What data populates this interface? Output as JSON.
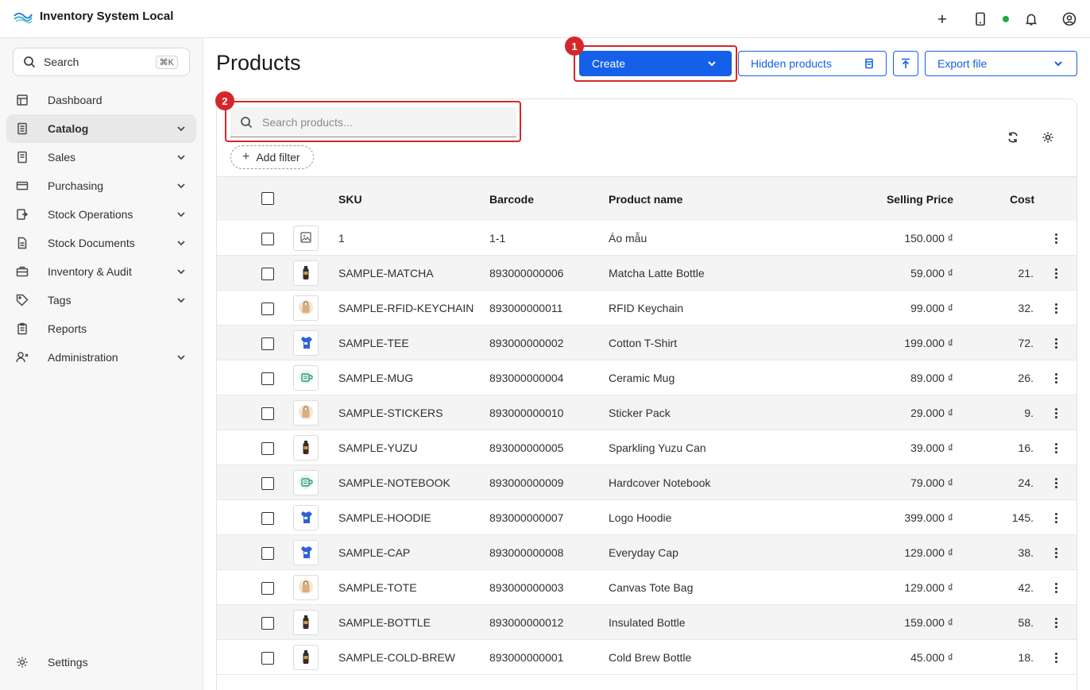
{
  "app": {
    "title": "Inventory System Local"
  },
  "sidebar": {
    "search_label": "Search",
    "search_shortcut": "⌘K",
    "items": [
      {
        "label": "Dashboard",
        "icon": "dashboard-icon",
        "chevron": false,
        "active": false
      },
      {
        "label": "Catalog",
        "icon": "catalog-icon",
        "chevron": true,
        "active": true
      },
      {
        "label": "Sales",
        "icon": "sales-icon",
        "chevron": true,
        "active": false
      },
      {
        "label": "Purchasing",
        "icon": "card-icon",
        "chevron": true,
        "active": false
      },
      {
        "label": "Stock Operations",
        "icon": "stock-operations-icon",
        "chevron": true,
        "active": false
      },
      {
        "label": "Stock Documents",
        "icon": "document-icon",
        "chevron": true,
        "active": false
      },
      {
        "label": "Inventory & Audit",
        "icon": "inventory-icon",
        "chevron": true,
        "active": false
      },
      {
        "label": "Tags",
        "icon": "tag-icon",
        "chevron": true,
        "active": false
      },
      {
        "label": "Reports",
        "icon": "report-icon",
        "chevron": false,
        "active": false
      },
      {
        "label": "Administration",
        "icon": "admin-icon",
        "chevron": true,
        "active": false
      }
    ],
    "settings_label": "Settings"
  },
  "page": {
    "title": "Products"
  },
  "toolbar": {
    "create_label": "Create",
    "hidden_label": "Hidden products",
    "export_label": "Export file"
  },
  "annotations": {
    "first": "1",
    "second": "2"
  },
  "filters": {
    "search_placeholder": "Search products...",
    "add_filter_label": "Add filter"
  },
  "table": {
    "headers": {
      "sku": "SKU",
      "barcode": "Barcode",
      "name": "Product name",
      "price": "Selling Price",
      "cost": "Cost"
    },
    "rows": [
      {
        "sku": "1",
        "barcode": "1-1",
        "name": "Áo mẫu",
        "price": "150.000 ₫",
        "cost": "",
        "thumb": "placeholder"
      },
      {
        "sku": "SAMPLE-MATCHA",
        "barcode": "893000000006",
        "name": "Matcha Latte Bottle",
        "price": "59.000 ₫",
        "cost": "21.",
        "thumb": "bottle"
      },
      {
        "sku": "SAMPLE-RFID-KEYCHAIN",
        "barcode": "893000000011",
        "name": "RFID Keychain",
        "price": "99.000 ₫",
        "cost": "32.",
        "thumb": "bag"
      },
      {
        "sku": "SAMPLE-TEE",
        "barcode": "893000000002",
        "name": "Cotton T-Shirt",
        "price": "199.000 ₫",
        "cost": "72.",
        "thumb": "shirt"
      },
      {
        "sku": "SAMPLE-MUG",
        "barcode": "893000000004",
        "name": "Ceramic Mug",
        "price": "89.000 ₫",
        "cost": "26.",
        "thumb": "mug"
      },
      {
        "sku": "SAMPLE-STICKERS",
        "barcode": "893000000010",
        "name": "Sticker Pack",
        "price": "29.000 ₫",
        "cost": "9.",
        "thumb": "bag"
      },
      {
        "sku": "SAMPLE-YUZU",
        "barcode": "893000000005",
        "name": "Sparkling Yuzu Can",
        "price": "39.000 ₫",
        "cost": "16.",
        "thumb": "bottle"
      },
      {
        "sku": "SAMPLE-NOTEBOOK",
        "barcode": "893000000009",
        "name": "Hardcover Notebook",
        "price": "79.000 ₫",
        "cost": "24.",
        "thumb": "mug"
      },
      {
        "sku": "SAMPLE-HOODIE",
        "barcode": "893000000007",
        "name": "Logo Hoodie",
        "price": "399.000 ₫",
        "cost": "145.",
        "thumb": "shirt"
      },
      {
        "sku": "SAMPLE-CAP",
        "barcode": "893000000008",
        "name": "Everyday Cap",
        "price": "129.000 ₫",
        "cost": "38.",
        "thumb": "shirt"
      },
      {
        "sku": "SAMPLE-TOTE",
        "barcode": "893000000003",
        "name": "Canvas Tote Bag",
        "price": "129.000 ₫",
        "cost": "42.",
        "thumb": "bag"
      },
      {
        "sku": "SAMPLE-BOTTLE",
        "barcode": "893000000012",
        "name": "Insulated Bottle",
        "price": "159.000 ₫",
        "cost": "58.",
        "thumb": "bottle"
      },
      {
        "sku": "SAMPLE-COLD-BREW",
        "barcode": "893000000001",
        "name": "Cold Brew Bottle",
        "price": "45.000 ₫",
        "cost": "18.",
        "thumb": "bottle"
      }
    ]
  },
  "colors": {
    "primary": "#1460e8",
    "annotation": "#d6262b",
    "status_online": "#22a84a"
  }
}
